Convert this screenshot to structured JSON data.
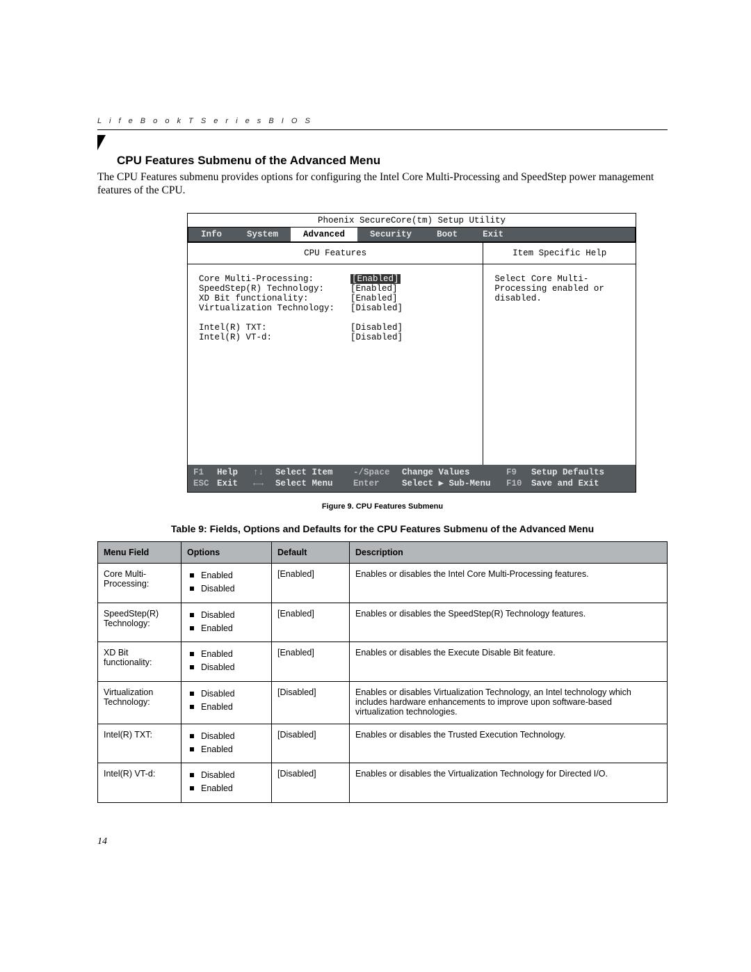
{
  "running_head": "L i f e B o o k   T   S e r i e s   B I O S",
  "section_title": "CPU Features Submenu of the Advanced Menu",
  "intro": "The CPU Features submenu provides options for configuring the Intel Core Multi-Processing and SpeedStep power management features of the CPU.",
  "bios": {
    "title": "Phoenix SecureCore(tm) Setup Utility",
    "tabs": [
      "Info",
      "System",
      "Advanced",
      "Security",
      "Boot",
      "Exit"
    ],
    "active_tab": "Advanced",
    "main_header": "CPU Features",
    "help_header": "Item Specific Help",
    "help_text": "Select Core Multi-Processing enabled or disabled.",
    "options": [
      {
        "label": "Core Multi-Processing:",
        "value": "[Enabled]",
        "selected": true
      },
      {
        "label": "SpeedStep(R) Technology:",
        "value": "[Enabled]",
        "selected": false
      },
      {
        "label": "XD Bit functionality:",
        "value": "[Enabled]",
        "selected": false
      },
      {
        "label": "Virtualization Technology:",
        "value": "[Disabled]",
        "selected": false
      },
      {
        "_gap": true
      },
      {
        "label": "Intel(R) TXT:",
        "value": "[Disabled]",
        "selected": false
      },
      {
        "label": "Intel(R) VT-d:",
        "value": "[Disabled]",
        "selected": false
      }
    ],
    "footer": {
      "row1": {
        "k1": "F1",
        "k1_label": "Help",
        "nav": "↑↓",
        "nav_label": "Select Item",
        "k2": "-/Space",
        "k2_label": "Change Values",
        "k3": "F9",
        "k3_label": "Setup Defaults"
      },
      "row2": {
        "k1": "ESC",
        "k1_label": "Exit",
        "nav": "←→",
        "nav_label": "Select Menu",
        "k2": "Enter",
        "k2_label": "Select ▶ Sub-Menu",
        "k3": "F10",
        "k3_label": "Save and Exit"
      }
    }
  },
  "figure_caption": "Figure 9.  CPU Features Submenu",
  "table_title": "Table 9: Fields, Options and Defaults for the CPU Features Submenu of the Advanced Menu",
  "table_headers": [
    "Menu Field",
    "Options",
    "Default",
    "Description"
  ],
  "table_rows": [
    {
      "field": "Core Multi-Processing:",
      "options": [
        "Enabled",
        "Disabled"
      ],
      "def": "[Enabled]",
      "desc": "Enables or disables the Intel Core Multi-Processing features."
    },
    {
      "field": "SpeedStep(R) Technology:",
      "options": [
        "Disabled",
        "Enabled"
      ],
      "def": "[Enabled]",
      "desc": "Enables or disables the SpeedStep(R) Technology features."
    },
    {
      "field": "XD Bit functionality:",
      "options": [
        "Enabled",
        "Disabled"
      ],
      "def": "[Enabled]",
      "desc": "Enables or disables the Execute Disable Bit feature."
    },
    {
      "field": "Virtualization Technology:",
      "options": [
        "Disabled",
        "Enabled"
      ],
      "def": "[Disabled]",
      "desc": "Enables or disables Virtualization Technology, an Intel technology which includes hardware enhancements to improve upon software-based virtualization technologies."
    },
    {
      "field": "Intel(R) TXT:",
      "options": [
        "Disabled",
        "Enabled"
      ],
      "def": "[Disabled]",
      "desc": "Enables or disables the Trusted Execution Technology."
    },
    {
      "field": "Intel(R) VT-d:",
      "options": [
        "Disabled",
        "Enabled"
      ],
      "def": "[Disabled]",
      "desc": "Enables or disables the Virtualization Technology for Directed I/O."
    }
  ],
  "page_number": "14"
}
